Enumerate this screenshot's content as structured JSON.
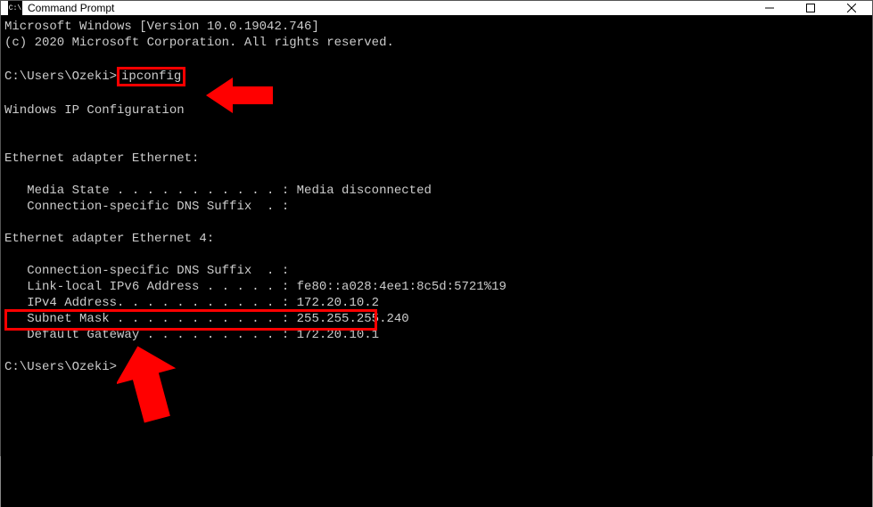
{
  "window": {
    "title": "Command Prompt"
  },
  "terminal": {
    "version_line": "Microsoft Windows [Version 10.0.19042.746]",
    "copyright_line": "(c) 2020 Microsoft Corporation. All rights reserved.",
    "prompt1_prefix": "C:\\Users\\Ozeki>",
    "command": "ipconfig",
    "header1": "Windows IP Configuration",
    "adapter1_title": "Ethernet adapter Ethernet:",
    "adapter1_media": "   Media State . . . . . . . . . . . : Media disconnected",
    "adapter1_suffix": "   Connection-specific DNS Suffix  . :",
    "adapter2_title": "Ethernet adapter Ethernet 4:",
    "adapter2_suffix": "   Connection-specific DNS Suffix  . :",
    "adapter2_ipv6": "   Link-local IPv6 Address . . . . . : fe80::a028:4ee1:8c5d:5721%19",
    "adapter2_ipv4": "   IPv4 Address. . . . . . . . . . . : 172.20.10.2",
    "adapter2_mask": "   Subnet Mask . . . . . . . . . . . : 255.255.255.240",
    "adapter2_gateway": "   Default Gateway . . . . . . . . . : 172.20.10.1",
    "prompt2": "C:\\Users\\Ozeki>"
  },
  "annotations": {
    "highlight_command": "ipconfig",
    "highlight_ipv4_value": "172.20.10.2",
    "arrow_color": "#ff0000"
  }
}
